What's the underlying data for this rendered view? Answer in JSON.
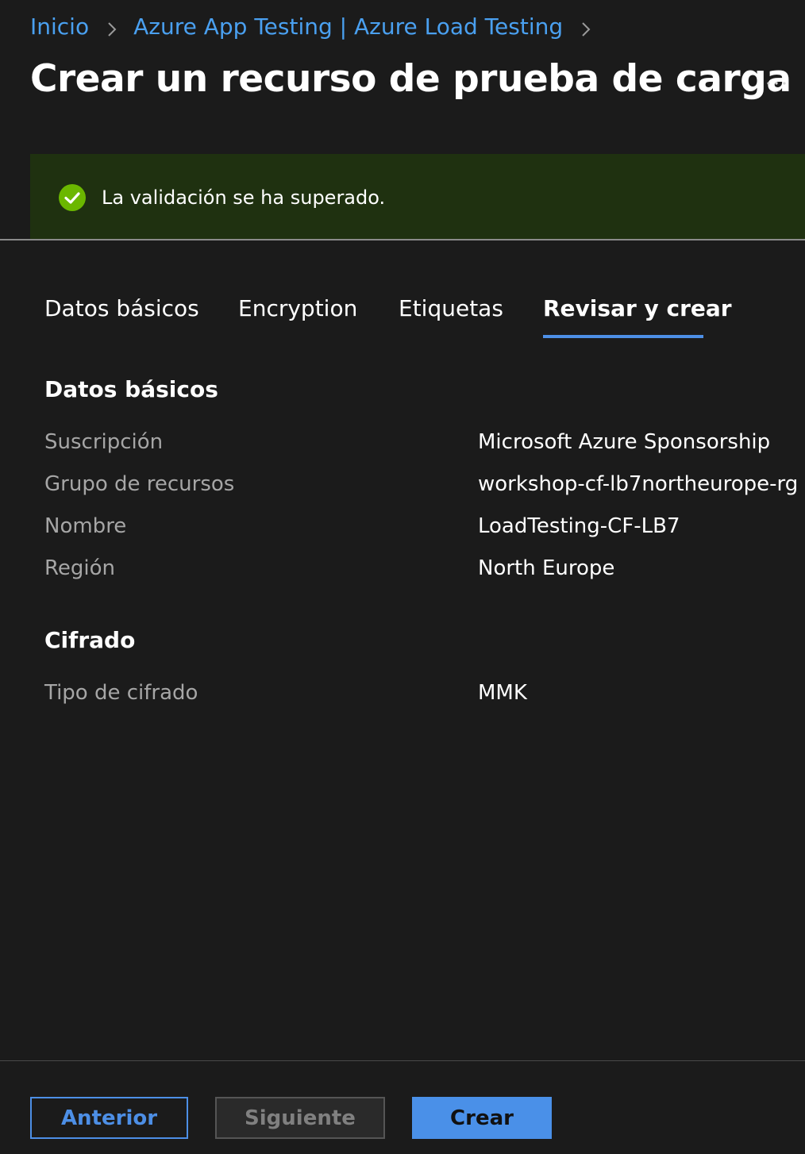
{
  "breadcrumb": {
    "items": [
      {
        "label": "Inicio"
      },
      {
        "label": "Azure App Testing | Azure Load Testing"
      }
    ]
  },
  "page": {
    "title": "Crear un recurso de prueba de carga",
    "more_label": "..."
  },
  "banner": {
    "status": "success",
    "message": "La validación se ha superado.",
    "icon": "check-circle-icon",
    "color": "#6bb700"
  },
  "tabs": [
    {
      "label": "Datos básicos",
      "active": false
    },
    {
      "label": "Encryption",
      "active": false
    },
    {
      "label": "Etiquetas",
      "active": false
    },
    {
      "label": "Revisar y crear",
      "active": true
    }
  ],
  "sections": [
    {
      "title": "Datos básicos",
      "rows": [
        {
          "label": "Suscripción",
          "value": "Microsoft Azure Sponsorship"
        },
        {
          "label": "Grupo de recursos",
          "value": "workshop-cf-lb7northeurope-rg"
        },
        {
          "label": "Nombre",
          "value": "LoadTesting-CF-LB7"
        },
        {
          "label": "Región",
          "value": "North Europe"
        }
      ]
    },
    {
      "title": "Cifrado",
      "rows": [
        {
          "label": "Tipo de cifrado",
          "value": "MMK"
        }
      ]
    }
  ],
  "footer": {
    "previous_label": "Anterior",
    "next_label": "Siguiente",
    "next_disabled": true,
    "create_label": "Crear"
  },
  "colors": {
    "background": "#1b1b1b",
    "link": "#4aa0f0",
    "accent": "#4d8fe6",
    "success_banner": "#1f3110",
    "label_gray": "#a6a6a6"
  }
}
